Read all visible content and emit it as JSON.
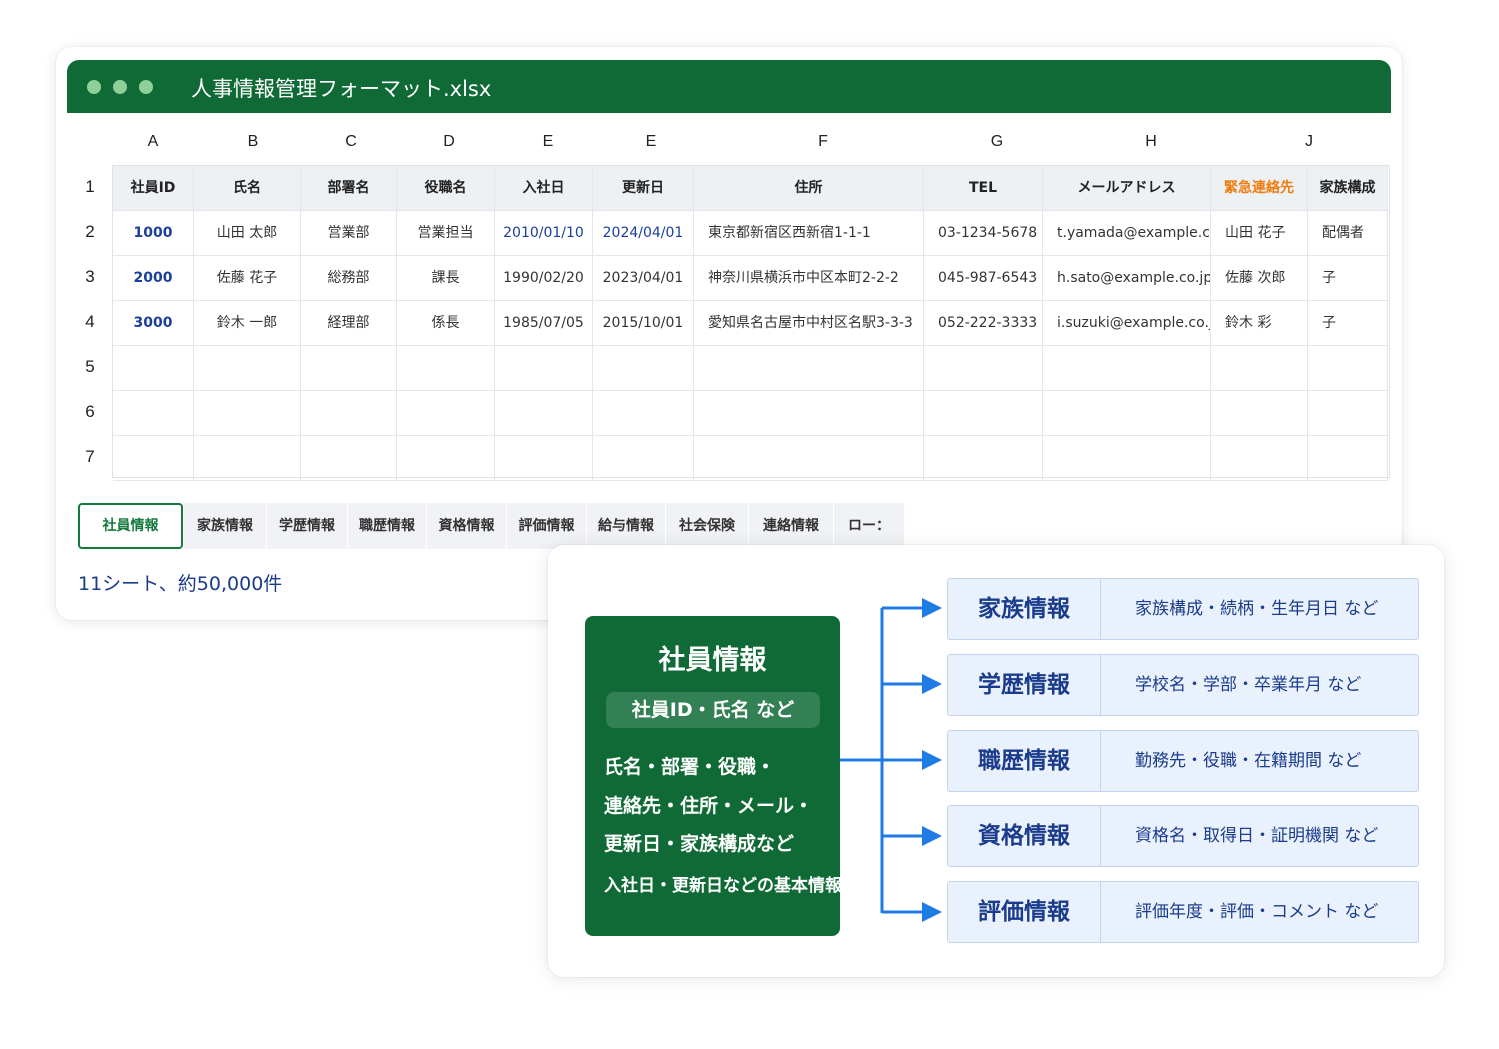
{
  "window": {
    "title": "人事情報管理フォーマット.xlsx"
  },
  "spreadsheet": {
    "column_letters": [
      "A",
      "B",
      "C",
      "D",
      "E",
      "E",
      "F",
      "G",
      "H",
      "J"
    ],
    "row_numbers": [
      "1",
      "2",
      "3",
      "4",
      "5",
      "6",
      "7"
    ],
    "headers": [
      "社員ID",
      "氏名",
      "部署名",
      "役職名",
      "入社日",
      "更新日",
      "住所",
      "TEL",
      "メールアドレス",
      "緊急連絡先",
      "家族構成"
    ],
    "rows": [
      [
        "1000",
        "山田 太郎",
        "営業部",
        "営業担当",
        "2010/01/10",
        "2024/04/01",
        "東京都新宿区西新宿1-1-1",
        "03-1234-5678",
        "t.yamada@example.co.jp",
        "山田 花子",
        "配偶者"
      ],
      [
        "2000",
        "佐藤 花子",
        "総務部",
        "課長",
        "1990/02/20",
        "2023/04/01",
        "神奈川県横浜市中区本町2-2-2",
        "045-987-6543",
        "h.sato@example.co.jp",
        "佐藤 次郎",
        "子"
      ],
      [
        "3000",
        "鈴木 一郎",
        "経理部",
        "係長",
        "1985/07/05",
        "2015/10/01",
        "愛知県名古屋市中村区名駅3-3-3",
        "052-222-3333",
        "i.suzuki@example.co.jp",
        "鈴木 彩",
        "子"
      ]
    ],
    "sheet_tabs": [
      "社員情報",
      "家族情報",
      "学歴情報",
      "職歴情報",
      "資格情報",
      "評価情報",
      "給与情報",
      "社会保険",
      "連絡情報",
      "ロー："
    ],
    "active_tab": "社員情報",
    "sheet_count": "11シート、約50,000件"
  },
  "diagram": {
    "main": {
      "title": "社員情報",
      "subtitle": "社員ID・氏名 など",
      "lines": [
        "氏名・部署・役職・",
        "連絡先・住所・メール・",
        "更新日・家族構成など",
        "入社日・更新日などの基本情報"
      ]
    },
    "related": [
      {
        "name": "家族情報",
        "desc": "家族構成・続柄・生年月日 など"
      },
      {
        "name": "学歴情報",
        "desc": "学校名・学部・卒業年月 など"
      },
      {
        "name": "職歴情報",
        "desc": "勤務先・役職・在籍期間 など"
      },
      {
        "name": "資格情報",
        "desc": "資格名・取得日・証明機関 など"
      },
      {
        "name": "評価情報",
        "desc": "評価年度・評価・コメント など"
      }
    ]
  },
  "colors": {
    "brand_green": "#0f6a36",
    "accent_blue": "#1f7be6",
    "link_navy": "#1b3c8c",
    "emergency_orange": "#f07d10"
  }
}
